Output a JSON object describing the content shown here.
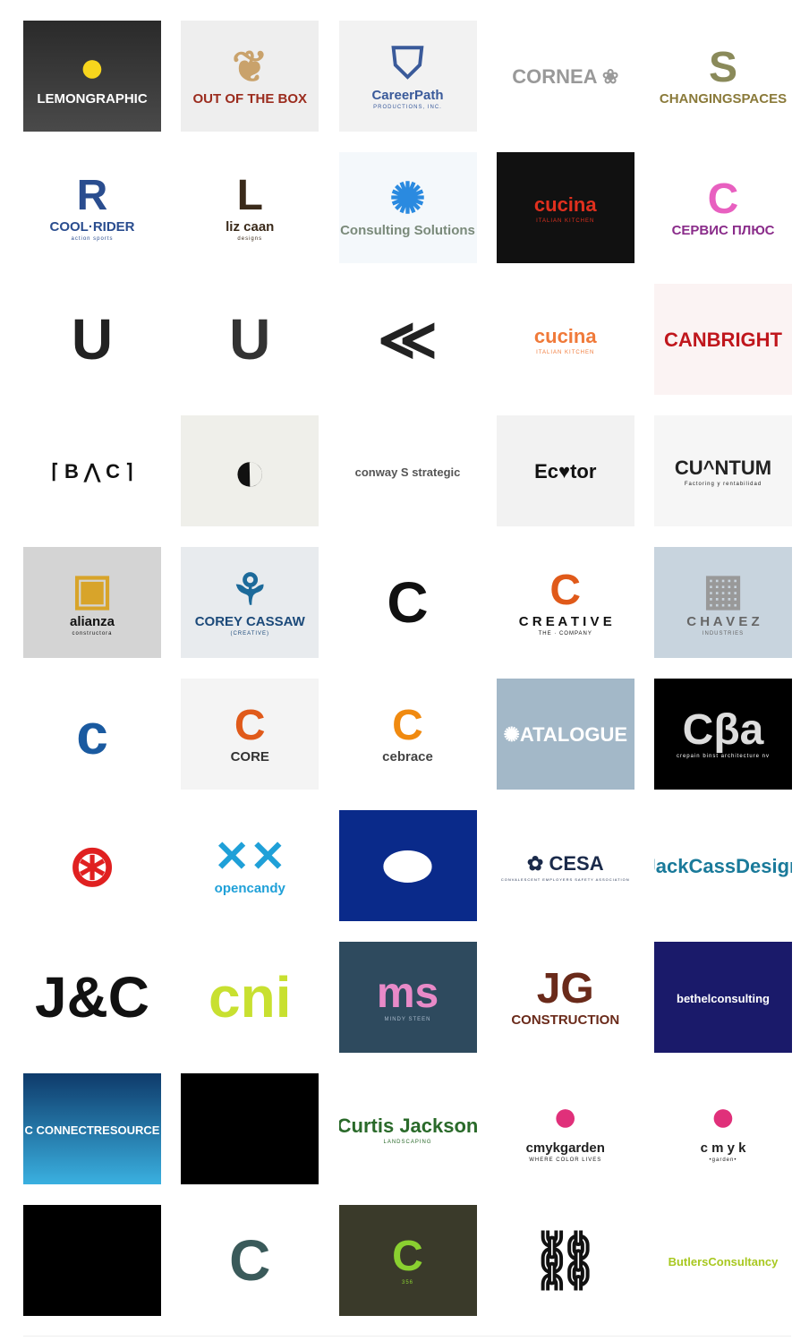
{
  "tiles": [
    {
      "name": "lemongraphic",
      "mark": "●",
      "mark_color": "#f7d51d",
      "text": "LEMONGRAPHIC",
      "sub": "",
      "bg": "#3a3a3a",
      "fg": "#ffffff"
    },
    {
      "name": "out-of-the-box",
      "mark": "❦",
      "mark_color": "#c9a26b",
      "text": "OUT OF THE BOX",
      "sub": "",
      "bg": "#eeeeee",
      "fg": "#9b2c1e"
    },
    {
      "name": "careerpath",
      "mark": "⛉",
      "mark_color": "#3a5a9a",
      "text": "CareerPath",
      "sub": "PRODUCTIONS, INC.",
      "bg": "#f2f2f2",
      "fg": "#3a5a9a"
    },
    {
      "name": "cornea",
      "mark": "",
      "mark_color": "#6cbf3c",
      "text": "CORNEA ❀",
      "sub": "",
      "bg": "#ffffff",
      "fg": "#999999"
    },
    {
      "name": "changingspaces",
      "mark": "S",
      "mark_color": "#8a8a5a",
      "text": "CHANGINGSPACES",
      "sub": "",
      "bg": "#ffffff",
      "fg": "#8a7a3a"
    },
    {
      "name": "cool-rider",
      "mark": "R",
      "mark_color": "#2a4d8f",
      "text": "COOL·RIDER",
      "sub": "action sports",
      "bg": "#ffffff",
      "fg": "#2a4d8f"
    },
    {
      "name": "liz-caan-designs",
      "mark": "L",
      "mark_color": "#3a2a1a",
      "text": "liz caan",
      "sub": "designs",
      "bg": "#ffffff",
      "fg": "#3a2a1a"
    },
    {
      "name": "consulting-solutions",
      "mark": "✺",
      "mark_color": "#2a8ae0",
      "text": "Consulting Solutions",
      "sub": "",
      "bg": "#f4f8fb",
      "fg": "#7a8a7a"
    },
    {
      "name": "cucina-italian-kitchen",
      "mark": "",
      "mark_color": "#d8261b",
      "text": "cucina",
      "sub": "ITALIAN KITCHEN",
      "bg": "#111111",
      "fg": "#e0301e"
    },
    {
      "name": "servis-plyus",
      "mark": "C",
      "mark_color": "#e860c0",
      "text": "СЕРВИС ПЛЮС",
      "sub": "",
      "bg": "#ffffff",
      "fg": "#8a2c8a"
    },
    {
      "name": "u-mark-1",
      "mark": "U",
      "mark_color": "#222222",
      "text": "",
      "sub": "",
      "bg": "#ffffff",
      "fg": "#222222"
    },
    {
      "name": "u-mark-2",
      "mark": "U",
      "mark_color": "#333333",
      "text": "",
      "sub": "",
      "bg": "#ffffff",
      "fg": "#333333"
    },
    {
      "name": "chevron-mark",
      "mark": "≪",
      "mark_color": "#222222",
      "text": "",
      "sub": "",
      "bg": "#ffffff",
      "fg": "#222222"
    },
    {
      "name": "cucina-ornament",
      "mark": "",
      "mark_color": "#f07a3a",
      "text": "cucina",
      "sub": "ITALIAN KITCHEN",
      "bg": "#ffffff",
      "fg": "#f07a3a"
    },
    {
      "name": "canbright",
      "mark": "",
      "mark_color": "#c0161c",
      "text": "CANBRIGHT",
      "sub": "",
      "bg": "#fbf3f3",
      "fg": "#c0161c"
    },
    {
      "name": "bc-glasses",
      "mark": "",
      "mark_color": "#111111",
      "text": "⌈ B ⋀ C ⌉",
      "sub": "",
      "bg": "#ffffff",
      "fg": "#111111"
    },
    {
      "name": "moon-mark",
      "mark": "◐",
      "mark_color": "#111111",
      "text": "",
      "sub": "",
      "bg": "#efefea",
      "fg": "#111111"
    },
    {
      "name": "conway-strategic",
      "mark": "",
      "mark_color": "#f0a020",
      "text": "conway S strategic",
      "sub": "",
      "bg": "#ffffff",
      "fg": "#555555"
    },
    {
      "name": "ecator",
      "mark": "",
      "mark_color": "#e01a3a",
      "text": "Ec♥tor",
      "sub": "",
      "bg": "#f2f2f2",
      "fg": "#111111"
    },
    {
      "name": "cuantum",
      "mark": "",
      "mark_color": "#d01a1a",
      "text": "CU^NTUM",
      "sub": "Factoring y rentabilidad",
      "bg": "#f6f6f6",
      "fg": "#222222"
    },
    {
      "name": "alianza-constructora",
      "mark": "▣",
      "mark_color": "#d8a42a",
      "text": "alianza",
      "sub": "constructora",
      "bg": "#d4d4d4",
      "fg": "#111111"
    },
    {
      "name": "corey-cassaw",
      "mark": "⚘",
      "mark_color": "#1c6a9a",
      "text": "COREY CASSAW",
      "sub": "(CREATIVE)",
      "bg": "#e8ebee",
      "fg": "#1c4a7a"
    },
    {
      "name": "c-swoosh",
      "mark": "C",
      "mark_color": "#111111",
      "text": "",
      "sub": "",
      "bg": "#ffffff",
      "fg": "#111111"
    },
    {
      "name": "the-creative-company",
      "mark": "C",
      "mark_color": "#e05a1a",
      "text": "C R E A T I V E",
      "sub": "THE · COMPANY",
      "bg": "#ffffff",
      "fg": "#111111"
    },
    {
      "name": "chavez-industries",
      "mark": "▦",
      "mark_color": "#999999",
      "text": "C H A V E Z",
      "sub": "INDUSTRIES",
      "bg": "#c8d4de",
      "fg": "#666666"
    },
    {
      "name": "blue-c",
      "mark": "c",
      "mark_color": "#1a5aa0",
      "text": "",
      "sub": "",
      "bg": "#ffffff",
      "fg": "#1a5aa0"
    },
    {
      "name": "core",
      "mark": "C",
      "mark_color": "#e05a1a",
      "text": "CORE",
      "sub": "",
      "bg": "#f4f4f4",
      "fg": "#333333"
    },
    {
      "name": "cebrace",
      "mark": "C",
      "mark_color": "#f08a10",
      "text": "cebrace",
      "sub": "",
      "bg": "#ffffff",
      "fg": "#444444"
    },
    {
      "name": "catalogue",
      "mark": "",
      "mark_color": "#ffffff",
      "text": "✺ATALOGUE",
      "sub": "",
      "bg": "#a3b8c8",
      "fg": "#ffffff"
    },
    {
      "name": "crepain-binst",
      "mark": "Cβa",
      "mark_color": "#dddddd",
      "text": "",
      "sub": "crepain binst architecture nv",
      "bg": "#000000",
      "fg": "#ffffff"
    },
    {
      "name": "red-circle-mark",
      "mark": "⊛",
      "mark_color": "#e02020",
      "text": "",
      "sub": "",
      "bg": "#ffffff",
      "fg": "#e02020"
    },
    {
      "name": "opencandy",
      "mark": "✕✕",
      "mark_color": "#1fa0d8",
      "text": "opencandy",
      "sub": "",
      "bg": "#ffffff",
      "fg": "#1fa0d8"
    },
    {
      "name": "blue-c-disc",
      "mark": "⬬",
      "mark_color": "#ffffff",
      "text": "",
      "sub": "",
      "bg": "#0a2a8a",
      "fg": "#ffffff"
    },
    {
      "name": "cesa",
      "mark": "",
      "mark_color": "#1a3a6a",
      "text": "✿ CESA",
      "sub": "CONVALESCENT EMPLOYERS SAFETY ASSOCIATION",
      "bg": "#ffffff",
      "fg": "#1a2a4a"
    },
    {
      "name": "jackcassdesign",
      "mark": "",
      "mark_color": "#1aa0c0",
      "text": "JackCassDesign",
      "sub": "",
      "bg": "#ffffff",
      "fg": "#1a7a9a"
    },
    {
      "name": "j-and-c",
      "mark": "J&C",
      "mark_color": "#111111",
      "text": "",
      "sub": "",
      "bg": "#ffffff",
      "fg": "#111111"
    },
    {
      "name": "cni",
      "mark": "cni",
      "mark_color": "#c8e030",
      "text": "",
      "sub": "",
      "bg": "#ffffff",
      "fg": "#c8e030"
    },
    {
      "name": "mindy-steen",
      "mark": "ms",
      "mark_color": "#e88ac8",
      "text": "",
      "sub": "MINDY STEEN",
      "bg": "#2e4a5e",
      "fg": "#aabbcc"
    },
    {
      "name": "jg-construction",
      "mark": "JG",
      "mark_color": "#6a2a1a",
      "text": "CONSTRUCTION",
      "sub": "",
      "bg": "#ffffff",
      "fg": "#6a2a1a"
    },
    {
      "name": "bethelconsulting",
      "mark": "",
      "mark_color": "#f08a10",
      "text": "bethelconsulting",
      "sub": "",
      "bg": "#1a1a6a",
      "fg": "#ffffff"
    },
    {
      "name": "connectresource",
      "mark": "",
      "mark_color": "#ffffff",
      "text": "C CONNECTRESOURCE",
      "sub": "",
      "bg": "#1a6aa8",
      "fg": "#ffffff"
    },
    {
      "name": "black-tile-1",
      "mark": "",
      "mark_color": "#000000",
      "text": "",
      "sub": "",
      "bg": "#000000",
      "fg": "#000000"
    },
    {
      "name": "curtis-jackson",
      "mark": "",
      "mark_color": "#5aa030",
      "text": "Curtis Jackson",
      "sub": "LANDSCAPING",
      "bg": "#ffffff",
      "fg": "#2a6a2a"
    },
    {
      "name": "cmykgarden",
      "mark": "●",
      "mark_color": "#e0307a",
      "text": "cmykgarden",
      "sub": "WHERE COLOR LIVES",
      "bg": "#ffffff",
      "fg": "#222222"
    },
    {
      "name": "cmyk-garden",
      "mark": "●",
      "mark_color": "#e0307a",
      "text": "c m y k",
      "sub": "•garden•",
      "bg": "#ffffff",
      "fg": "#222222"
    },
    {
      "name": "black-tile-2",
      "mark": "",
      "mark_color": "#000000",
      "text": "",
      "sub": "",
      "bg": "#000000",
      "fg": "#000000"
    },
    {
      "name": "c-arrow",
      "mark": "C",
      "mark_color": "#3a5a5a",
      "text": "",
      "sub": "",
      "bg": "#ffffff",
      "fg": "#3a5a5a"
    },
    {
      "name": "c356",
      "mark": "C",
      "mark_color": "#8ad030",
      "text": "",
      "sub": "356",
      "bg": "#3a3a2a",
      "fg": "#8ad030"
    },
    {
      "name": "chains-lock",
      "mark": "⛓",
      "mark_color": "#111111",
      "text": "",
      "sub": "",
      "bg": "#ffffff",
      "fg": "#111111"
    },
    {
      "name": "butlersconsultancy",
      "mark": "",
      "mark_color": "#999999",
      "text": "ButlersConsultancy",
      "sub": "",
      "bg": "#ffffff",
      "fg": "#a8c820"
    }
  ]
}
